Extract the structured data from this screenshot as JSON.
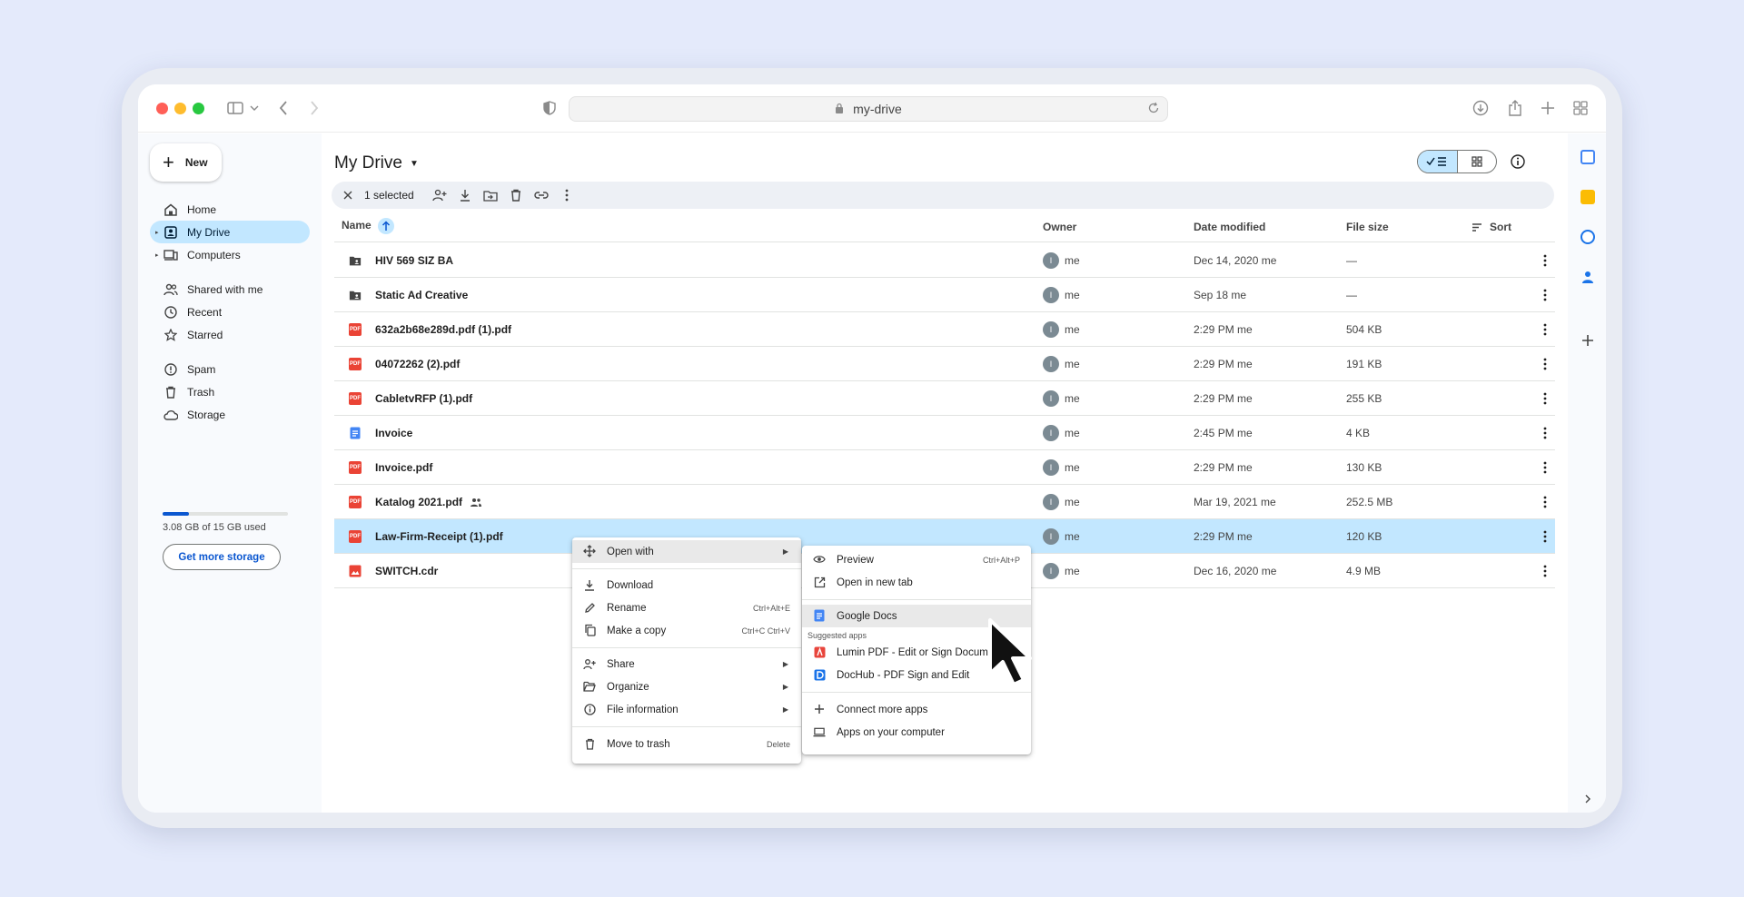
{
  "browser": {
    "url": "my-drive"
  },
  "nav": {
    "new_label": "New",
    "items": [
      {
        "label": "Home"
      },
      {
        "label": "My Drive"
      },
      {
        "label": "Computers"
      },
      {
        "label": "Shared with me"
      },
      {
        "label": "Recent"
      },
      {
        "label": "Starred"
      },
      {
        "label": "Spam"
      },
      {
        "label": "Trash"
      },
      {
        "label": "Storage"
      }
    ],
    "storage_text": "3.08 GB of 15 GB used",
    "storage_used_fraction": 0.21,
    "get_storage_label": "Get more storage"
  },
  "main": {
    "title": "My Drive",
    "selection_text": "1 selected",
    "columns": {
      "name": "Name",
      "owner": "Owner",
      "date": "Date modified",
      "size": "File size",
      "sort": "Sort"
    },
    "files": [
      {
        "name": "HIV 569 SIZ BA",
        "type": "folder",
        "owner_initial": "I",
        "owner": "me",
        "date": "Dec 14, 2020 me",
        "size": "—"
      },
      {
        "name": "Static Ad Creative",
        "type": "folder",
        "owner_initial": "I",
        "owner": "me",
        "date": "Sep 18 me",
        "size": "—"
      },
      {
        "name": "632a2b68e289d.pdf (1).pdf",
        "type": "pdf",
        "owner_initial": "I",
        "owner": "me",
        "date": "2:29 PM me",
        "size": "504 KB"
      },
      {
        "name": "04072262 (2).pdf",
        "type": "pdf",
        "owner_initial": "I",
        "owner": "me",
        "date": "2:29 PM me",
        "size": "191 KB"
      },
      {
        "name": "CabletvRFP (1).pdf",
        "type": "pdf",
        "owner_initial": "I",
        "owner": "me",
        "date": "2:29 PM me",
        "size": "255 KB"
      },
      {
        "name": "Invoice",
        "type": "doc",
        "owner_initial": "I",
        "owner": "me",
        "date": "2:45 PM me",
        "size": "4 KB"
      },
      {
        "name": "Invoice.pdf",
        "type": "pdf",
        "owner_initial": "I",
        "owner": "me",
        "date": "2:29 PM me",
        "size": "130 KB"
      },
      {
        "name": "Katalog 2021.pdf",
        "type": "pdf",
        "owner_initial": "I",
        "owner": "me",
        "date": "Mar 19, 2021 me",
        "size": "252.5 MB"
      },
      {
        "name": "Law-Firm-Receipt (1).pdf",
        "type": "pdf",
        "owner_initial": "I",
        "owner": "me",
        "date": "2:29 PM me",
        "size": "120 KB"
      },
      {
        "name": "SWITCH.cdr",
        "type": "img",
        "owner_initial": "I",
        "owner": "me",
        "date": "Dec 16, 2020 me",
        "size": "4.9 MB"
      }
    ],
    "pdf_badge": "PDF"
  },
  "context_menu": {
    "open_with": "Open with",
    "download": "Download",
    "rename": "Rename",
    "rename_shortcut": "Ctrl+Alt+E",
    "make_copy": "Make a copy",
    "make_copy_shortcut": "Ctrl+C Ctrl+V",
    "share": "Share",
    "organize": "Organize",
    "file_info": "File information",
    "move_trash": "Move to trash",
    "move_trash_shortcut": "Delete"
  },
  "submenu": {
    "preview": "Preview",
    "preview_shortcut": "Ctrl+Alt+P",
    "open_new_tab": "Open in new tab",
    "google_docs": "Google Docs",
    "suggested_label": "Suggested apps",
    "lumin": "Lumin PDF - Edit or Sign Documents",
    "dochub": "DocHub - PDF Sign and Edit",
    "connect_more": "Connect more apps",
    "apps_on_computer": "Apps on your computer"
  }
}
